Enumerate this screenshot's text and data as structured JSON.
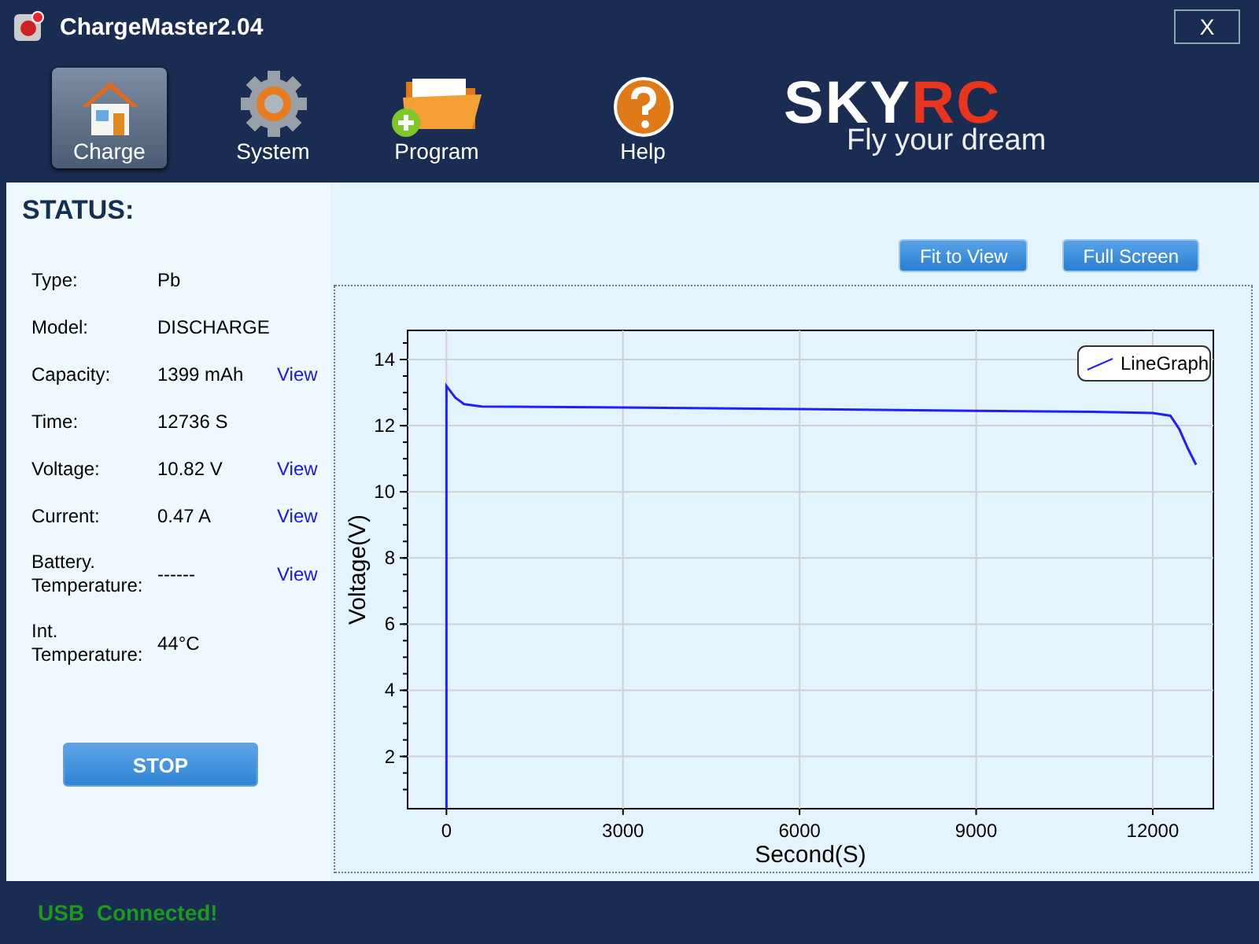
{
  "window": {
    "title": "ChargeMaster2.04",
    "close": "X"
  },
  "toolbar": [
    {
      "label": "Charge",
      "selected": true
    },
    {
      "label": "System",
      "selected": false
    },
    {
      "label": "Program",
      "selected": false
    },
    {
      "label": "Help",
      "selected": false
    }
  ],
  "logo": {
    "brand_a": "SKY",
    "brand_b": "RC",
    "tagline": "Fly your dream"
  },
  "status": {
    "title": "STATUS:",
    "rows": [
      {
        "label": "Type:",
        "value": "Pb"
      },
      {
        "label": "Model:",
        "value": "DISCHARGE"
      },
      {
        "label": "Capacity:",
        "value": "1399 mAh",
        "link": "View"
      },
      {
        "label": "Time:",
        "value": "12736 S"
      },
      {
        "label": "Voltage:",
        "value": "10.82 V",
        "link": "View"
      },
      {
        "label": "Current:",
        "value": "0.47 A",
        "link": "View"
      },
      {
        "label": "Battery. Temperature:",
        "value": "------",
        "link": "View"
      },
      {
        "label": "Int. Temperature:",
        "value": "44°C"
      }
    ],
    "button": "STOP"
  },
  "graph": {
    "buttons": [
      "Fit to View",
      "Full Screen"
    ],
    "chart_data": {
      "type": "line",
      "grid": true,
      "xlabel": "Second(S)",
      "ylabel": "Voltage(V)",
      "xlim": [
        -660,
        13030
      ],
      "ylim": [
        0.42,
        14.88
      ],
      "xticks": [
        0,
        3000,
        6000,
        9000,
        12000
      ],
      "yticks": [
        2,
        4,
        6,
        8,
        10,
        12,
        14
      ],
      "x": [
        0,
        0,
        150,
        300,
        600,
        3000,
        6000,
        9000,
        11000,
        12000,
        12300,
        12450,
        12600,
        12736
      ],
      "series": [
        {
          "name": "LineGraph",
          "color": "#2020ff",
          "values": [
            0.42,
            13.2,
            12.85,
            12.65,
            12.58,
            12.55,
            12.5,
            12.45,
            12.42,
            12.38,
            12.3,
            11.9,
            11.3,
            10.82
          ]
        }
      ]
    }
  },
  "status_bar": {
    "message": "USB  Connected!"
  }
}
